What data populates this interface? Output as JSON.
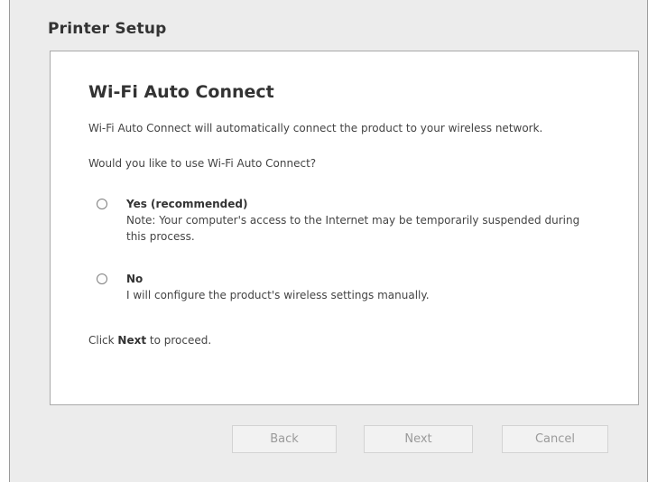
{
  "window": {
    "title": "Printer Setup"
  },
  "panel": {
    "heading": "Wi-Fi Auto Connect",
    "description": "Wi-Fi Auto Connect will automatically connect the product to your wireless network.",
    "question": "Would you like to use Wi-Fi Auto Connect?",
    "options": [
      {
        "label": "Yes (recommended)",
        "note": "Note: Your computer's access to the Internet may be temporarily suspended during this process.",
        "selected": false
      },
      {
        "label": "No",
        "note": "I will configure the product's wireless settings manually.",
        "selected": false
      }
    ],
    "proceed": {
      "prefix": "Click ",
      "emphasis": "Next",
      "suffix": " to proceed."
    }
  },
  "buttons": {
    "back": "Back",
    "next": "Next",
    "cancel": "Cancel"
  },
  "colors": {
    "window_bg": "#ececec",
    "panel_bg": "#ffffff",
    "disabled_text": "#9a9a9a"
  }
}
